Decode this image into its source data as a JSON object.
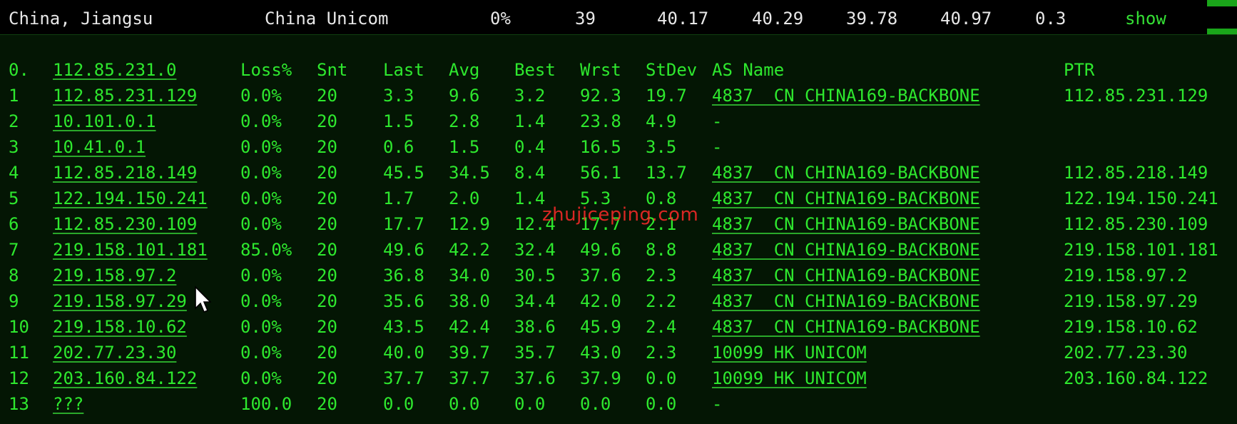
{
  "summary": {
    "location": "China, Jiangsu",
    "isp": "China Unicom",
    "loss": "0%",
    "snt": "39",
    "last": "40.17",
    "avg": "40.29",
    "best": "39.78",
    "wrst": "40.97",
    "stdev": "0.3",
    "action": "show"
  },
  "headers": {
    "hop": "0.",
    "host": "112.85.231.0",
    "loss": "Loss%",
    "snt": "Snt",
    "last": "Last",
    "avg": "Avg",
    "best": "Best",
    "wrst": "Wrst",
    "stdev": "StDev",
    "asname": "AS Name",
    "ptr": "PTR"
  },
  "rows": [
    {
      "hop": "1",
      "host": "112.85.231.129",
      "loss": "0.0%",
      "snt": "20",
      "last": "3.3",
      "avg": "9.6",
      "best": "3.2",
      "wrst": "92.3",
      "stdev": "19.7",
      "asname": "4837  CN CHINA169-BACKBONE",
      "ptr": "112.85.231.129"
    },
    {
      "hop": "2",
      "host": "10.101.0.1",
      "loss": "0.0%",
      "snt": "20",
      "last": "1.5",
      "avg": "2.8",
      "best": "1.4",
      "wrst": "23.8",
      "stdev": "4.9",
      "asname": "-",
      "ptr": ""
    },
    {
      "hop": "3",
      "host": "10.41.0.1",
      "loss": "0.0%",
      "snt": "20",
      "last": "0.6",
      "avg": "1.5",
      "best": "0.4",
      "wrst": "16.5",
      "stdev": "3.5",
      "asname": "-",
      "ptr": ""
    },
    {
      "hop": "4",
      "host": "112.85.218.149",
      "loss": "0.0%",
      "snt": "20",
      "last": "45.5",
      "avg": "34.5",
      "best": "8.4",
      "wrst": "56.1",
      "stdev": "13.7",
      "asname": "4837  CN CHINA169-BACKBONE",
      "ptr": "112.85.218.149"
    },
    {
      "hop": "5",
      "host": "122.194.150.241",
      "loss": "0.0%",
      "snt": "20",
      "last": "1.7",
      "avg": "2.0",
      "best": "1.4",
      "wrst": "5.3",
      "stdev": "0.8",
      "asname": "4837  CN CHINA169-BACKBONE",
      "ptr": "122.194.150.241"
    },
    {
      "hop": "6",
      "host": "112.85.230.109",
      "loss": "0.0%",
      "snt": "20",
      "last": "17.7",
      "avg": "12.9",
      "best": "12.4",
      "wrst": "17.7",
      "stdev": "2.1",
      "asname": "4837  CN CHINA169-BACKBONE",
      "ptr": "112.85.230.109"
    },
    {
      "hop": "7",
      "host": "219.158.101.181",
      "loss": "85.0%",
      "snt": "20",
      "last": "49.6",
      "avg": "42.2",
      "best": "32.4",
      "wrst": "49.6",
      "stdev": "8.8",
      "asname": "4837  CN CHINA169-BACKBONE",
      "ptr": "219.158.101.181"
    },
    {
      "hop": "8",
      "host": "219.158.97.2",
      "loss": "0.0%",
      "snt": "20",
      "last": "36.8",
      "avg": "34.0",
      "best": "30.5",
      "wrst": "37.6",
      "stdev": "2.3",
      "asname": "4837  CN CHINA169-BACKBONE",
      "ptr": "219.158.97.2"
    },
    {
      "hop": "9",
      "host": "219.158.97.29",
      "loss": "0.0%",
      "snt": "20",
      "last": "35.6",
      "avg": "38.0",
      "best": "34.4",
      "wrst": "42.0",
      "stdev": "2.2",
      "asname": "4837  CN CHINA169-BACKBONE",
      "ptr": "219.158.97.29"
    },
    {
      "hop": "10",
      "host": "219.158.10.62",
      "loss": "0.0%",
      "snt": "20",
      "last": "43.5",
      "avg": "42.4",
      "best": "38.6",
      "wrst": "45.9",
      "stdev": "2.4",
      "asname": "4837  CN CHINA169-BACKBONE",
      "ptr": "219.158.10.62"
    },
    {
      "hop": "11",
      "host": "202.77.23.30",
      "loss": "0.0%",
      "snt": "20",
      "last": "40.0",
      "avg": "39.7",
      "best": "35.7",
      "wrst": "43.0",
      "stdev": "2.3",
      "asname": "10099 HK UNICOM",
      "ptr": "202.77.23.30"
    },
    {
      "hop": "12",
      "host": "203.160.84.122",
      "loss": "0.0%",
      "snt": "20",
      "last": "37.7",
      "avg": "37.7",
      "best": "37.6",
      "wrst": "37.9",
      "stdev": "0.0",
      "asname": "10099 HK UNICOM",
      "ptr": "203.160.84.122"
    },
    {
      "hop": "13",
      "host": "???",
      "loss": "100.0",
      "snt": "20",
      "last": "0.0",
      "avg": "0.0",
      "best": "0.0",
      "wrst": "0.0",
      "stdev": "0.0",
      "asname": "-",
      "ptr": ""
    }
  ],
  "watermark": "zhujiceping.com",
  "icons": {
    "cursor": "mouse-pointer-icon"
  },
  "colors": {
    "text_green": "#2ee82e",
    "panel_bg": "#041604",
    "watermark": "#ff2a2a"
  }
}
